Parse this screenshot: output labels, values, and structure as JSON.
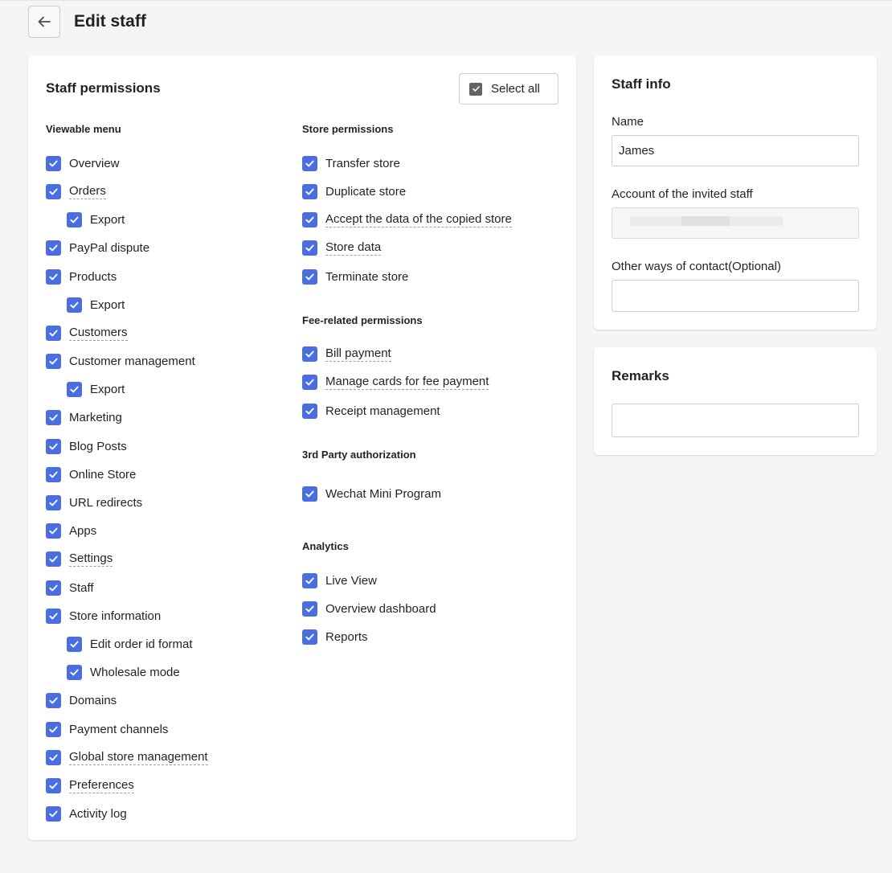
{
  "header": {
    "title": "Edit staff"
  },
  "permissions": {
    "title": "Staff permissions",
    "select_all_label": "Select all",
    "viewable_menu": {
      "title": "Viewable menu",
      "items": [
        {
          "label": "Overview",
          "checked": true,
          "indent": false,
          "dotted": false
        },
        {
          "label": "Orders",
          "checked": true,
          "indent": false,
          "dotted": true
        },
        {
          "label": "Export",
          "checked": true,
          "indent": true,
          "dotted": false
        },
        {
          "label": "PayPal dispute",
          "checked": true,
          "indent": false,
          "dotted": false
        },
        {
          "label": "Products",
          "checked": true,
          "indent": false,
          "dotted": false
        },
        {
          "label": "Export",
          "checked": true,
          "indent": true,
          "dotted": false
        },
        {
          "label": "Customers",
          "checked": true,
          "indent": false,
          "dotted": true
        },
        {
          "label": "Customer management",
          "checked": true,
          "indent": false,
          "dotted": false
        },
        {
          "label": "Export",
          "checked": true,
          "indent": true,
          "dotted": false
        },
        {
          "label": "Marketing",
          "checked": true,
          "indent": false,
          "dotted": false
        },
        {
          "label": "Blog Posts",
          "checked": true,
          "indent": false,
          "dotted": false
        },
        {
          "label": "Online Store",
          "checked": true,
          "indent": false,
          "dotted": false
        },
        {
          "label": "URL redirects",
          "checked": true,
          "indent": false,
          "dotted": false
        },
        {
          "label": "Apps",
          "checked": true,
          "indent": false,
          "dotted": false
        },
        {
          "label": "Settings",
          "checked": true,
          "indent": false,
          "dotted": true
        },
        {
          "label": "Staff",
          "checked": true,
          "indent": false,
          "dotted": false
        },
        {
          "label": "Store information",
          "checked": true,
          "indent": false,
          "dotted": false
        },
        {
          "label": "Edit order id format",
          "checked": true,
          "indent": true,
          "dotted": false
        },
        {
          "label": "Wholesale mode",
          "checked": true,
          "indent": true,
          "dotted": false
        },
        {
          "label": "Domains",
          "checked": true,
          "indent": false,
          "dotted": false
        },
        {
          "label": "Payment channels",
          "checked": true,
          "indent": false,
          "dotted": false
        },
        {
          "label": "Global store management",
          "checked": true,
          "indent": false,
          "dotted": true
        },
        {
          "label": "Preferences",
          "checked": true,
          "indent": false,
          "dotted": true
        },
        {
          "label": "Activity log",
          "checked": true,
          "indent": false,
          "dotted": false
        }
      ]
    },
    "store_permissions": {
      "title": "Store permissions",
      "items": [
        {
          "label": "Transfer store",
          "checked": true,
          "dotted": false
        },
        {
          "label": "Duplicate store",
          "checked": true,
          "dotted": false
        },
        {
          "label": "Accept the data of the copied store",
          "checked": true,
          "dotted": true
        },
        {
          "label": "Store data",
          "checked": true,
          "dotted": true
        },
        {
          "label": "Terminate store",
          "checked": true,
          "dotted": false
        }
      ]
    },
    "fee_permissions": {
      "title": "Fee-related permissions",
      "items": [
        {
          "label": "Bill payment",
          "checked": true,
          "dotted": true
        },
        {
          "label": "Manage cards for fee payment",
          "checked": true,
          "dotted": true
        },
        {
          "label": "Receipt management",
          "checked": true,
          "dotted": false
        }
      ]
    },
    "third_party": {
      "title": "3rd Party authorization",
      "items": [
        {
          "label": "Wechat Mini Program",
          "checked": true,
          "dotted": false
        }
      ]
    },
    "analytics": {
      "title": "Analytics",
      "items": [
        {
          "label": "Live View",
          "checked": true,
          "dotted": false
        },
        {
          "label": "Overview dashboard",
          "checked": true,
          "dotted": false
        },
        {
          "label": "Reports",
          "checked": true,
          "dotted": false
        }
      ]
    }
  },
  "staff_info": {
    "title": "Staff info",
    "name_label": "Name",
    "name_value": "James",
    "account_label": "Account of the invited staff",
    "contact_label": "Other ways of contact(Optional)",
    "contact_value": ""
  },
  "remarks": {
    "title": "Remarks",
    "value": ""
  },
  "colors": {
    "checkbox": "#4a6ee0",
    "background": "#f5f5f5"
  }
}
